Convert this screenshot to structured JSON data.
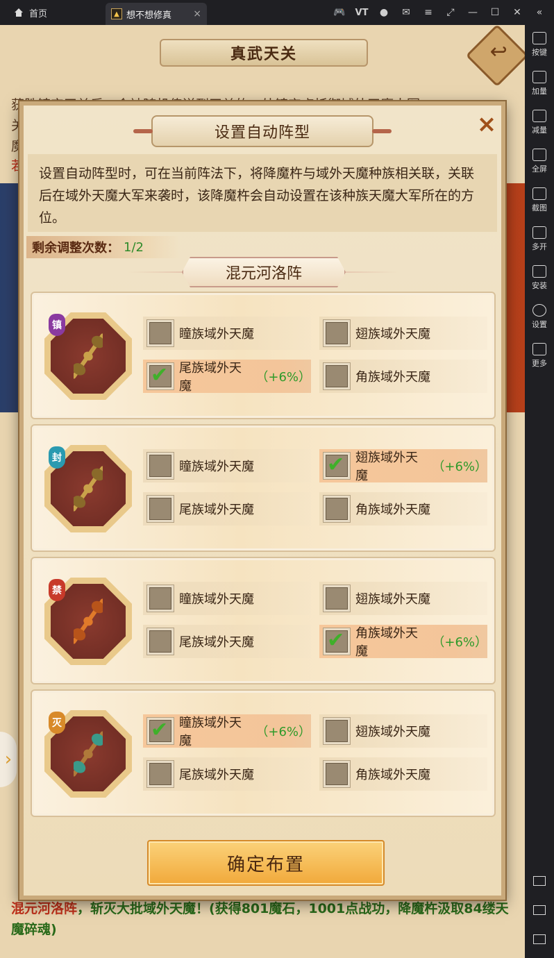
{
  "emulator": {
    "home_tab_label": "首页",
    "app_tab_label": "想不想修真",
    "app_tab_close": "×",
    "top_icons": [
      "gamepad-icon",
      "vt-icon",
      "user-icon",
      "mail-icon",
      "menu-icon",
      "fullscreen-icon",
      "minimize-icon",
      "maximize-icon",
      "close-icon",
      "collapse-icon"
    ],
    "vt_label": "VT",
    "sidebar": [
      {
        "label": "按键",
        "icon": "keyboard-icon"
      },
      {
        "label": "加量",
        "icon": "volume-up-icon"
      },
      {
        "label": "减量",
        "icon": "volume-down-icon"
      },
      {
        "label": "全屏",
        "icon": "fullscreen-icon"
      },
      {
        "label": "截图",
        "icon": "scissors-icon"
      },
      {
        "label": "多开",
        "icon": "multi-instance-icon"
      },
      {
        "label": "安装",
        "icon": "apk-icon"
      },
      {
        "label": "设置",
        "icon": "gear-icon"
      },
      {
        "label": "更多",
        "icon": "more-icon"
      }
    ]
  },
  "game": {
    "title": "真武天关",
    "bg_lines": [
      "获胜镇守天关后，会被随机传送到天关的一处镇守点抵御域外天魔大军",
      "关",
      "魔",
      "若"
    ],
    "bottom_text": {
      "red": "混元河洛阵",
      "green": "，斩灭大批域外天魔！(获得801魔石，1001点战功，降魔杵汲取84缕天魔碎魂)"
    }
  },
  "dialog": {
    "title": "设置自动阵型",
    "close": "×",
    "description": "设置自动阵型时，可在当前阵法下，将降魔杵与域外天魔种族相关联，关联后在域外天魔大军来袭时，该降魔杵会自动设置在该种族天魔大军所在的方位。",
    "remain_label": "剩余调整次数：",
    "remain_value": "1/2",
    "formation": "混元河洛阵",
    "confirm": "确定布置",
    "rows": [
      {
        "tag": "镇",
        "tag_color": "#8a3aa0",
        "options": [
          {
            "label": "瞳族域外天魔",
            "checked": false,
            "bonus": ""
          },
          {
            "label": "翅族域外天魔",
            "checked": false,
            "bonus": ""
          },
          {
            "label": "尾族域外天魔",
            "checked": true,
            "bonus": "（+6%）"
          },
          {
            "label": "角族域外天魔",
            "checked": false,
            "bonus": ""
          }
        ]
      },
      {
        "tag": "封",
        "tag_color": "#2a9ab0",
        "options": [
          {
            "label": "瞳族域外天魔",
            "checked": false,
            "bonus": ""
          },
          {
            "label": "翅族域外天魔",
            "checked": true,
            "bonus": "（+6%）"
          },
          {
            "label": "尾族域外天魔",
            "checked": false,
            "bonus": ""
          },
          {
            "label": "角族域外天魔",
            "checked": false,
            "bonus": ""
          }
        ]
      },
      {
        "tag": "禁",
        "tag_color": "#c83a2a",
        "options": [
          {
            "label": "瞳族域外天魔",
            "checked": false,
            "bonus": ""
          },
          {
            "label": "翅族域外天魔",
            "checked": false,
            "bonus": ""
          },
          {
            "label": "尾族域外天魔",
            "checked": false,
            "bonus": ""
          },
          {
            "label": "角族域外天魔",
            "checked": true,
            "bonus": "（+6%）"
          }
        ]
      },
      {
        "tag": "灭",
        "tag_color": "#d88a2a",
        "options": [
          {
            "label": "瞳族域外天魔",
            "checked": true,
            "bonus": "（+6%）"
          },
          {
            "label": "翅族域外天魔",
            "checked": false,
            "bonus": ""
          },
          {
            "label": "尾族域外天魔",
            "checked": false,
            "bonus": ""
          },
          {
            "label": "角族域外天魔",
            "checked": false,
            "bonus": ""
          }
        ]
      }
    ]
  }
}
